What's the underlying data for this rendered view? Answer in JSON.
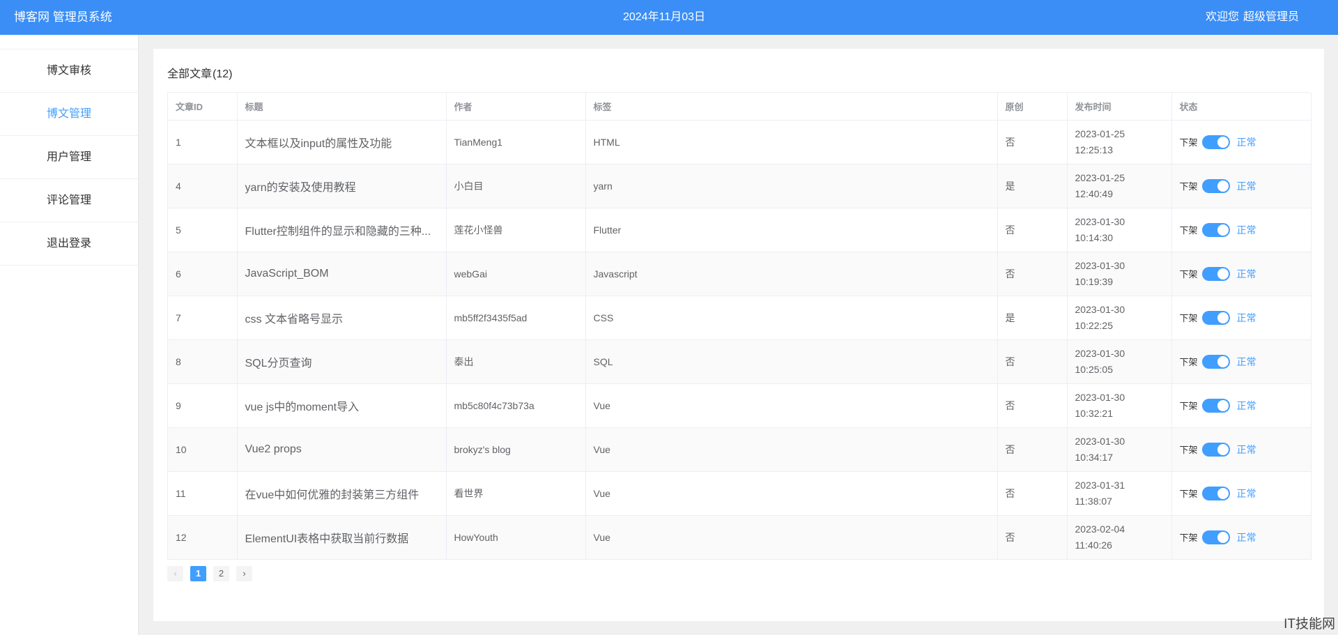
{
  "header": {
    "brand": "博客网 管理员系统",
    "date": "2024年11月03日",
    "welcome": "欢迎您",
    "role": "超级管理员"
  },
  "sidebar": {
    "items": [
      {
        "label": "博文审核"
      },
      {
        "label": "博文管理"
      },
      {
        "label": "用户管理"
      },
      {
        "label": "评论管理"
      },
      {
        "label": "退出登录"
      }
    ]
  },
  "main": {
    "title": "全部文章",
    "count": "(12)"
  },
  "table": {
    "columns": [
      "文章ID",
      "标题",
      "作者",
      "标签",
      "原创",
      "发布时间",
      "状态"
    ],
    "rows": [
      {
        "id": "1",
        "title": "文本框以及input的属性及功能",
        "author": "TianMeng1",
        "tag": "HTML",
        "original": "否",
        "date": "2023-01-25",
        "time": "12:25:13",
        "off": "下架",
        "status": "正常"
      },
      {
        "id": "4",
        "title": "yarn的安装及使用教程",
        "author": "小白目",
        "tag": "yarn",
        "original": "是",
        "date": "2023-01-25",
        "time": "12:40:49",
        "off": "下架",
        "status": "正常"
      },
      {
        "id": "5",
        "title": "Flutter控制组件的显示和隐藏的三种...",
        "author": "莲花小怪兽",
        "tag": "Flutter",
        "original": "否",
        "date": "2023-01-30",
        "time": "10:14:30",
        "off": "下架",
        "status": "正常"
      },
      {
        "id": "6",
        "title": "JavaScript_BOM",
        "author": "webGai",
        "tag": "Javascript",
        "original": "否",
        "date": "2023-01-30",
        "time": "10:19:39",
        "off": "下架",
        "status": "正常"
      },
      {
        "id": "7",
        "title": "css 文本省略号显示",
        "author": "mb5ff2f3435f5ad",
        "tag": "CSS",
        "original": "是",
        "date": "2023-01-30",
        "time": "10:22:25",
        "off": "下架",
        "status": "正常"
      },
      {
        "id": "8",
        "title": "SQL分页查询",
        "author": "泰出",
        "tag": "SQL",
        "original": "否",
        "date": "2023-01-30",
        "time": "10:25:05",
        "off": "下架",
        "status": "正常"
      },
      {
        "id": "9",
        "title": "vue js中的moment导入",
        "author": "mb5c80f4c73b73a",
        "tag": "Vue",
        "original": "否",
        "date": "2023-01-30",
        "time": "10:32:21",
        "off": "下架",
        "status": "正常"
      },
      {
        "id": "10",
        "title": "Vue2 props",
        "author": "brokyz's blog",
        "tag": "Vue",
        "original": "否",
        "date": "2023-01-30",
        "time": "10:34:17",
        "off": "下架",
        "status": "正常"
      },
      {
        "id": "11",
        "title": "在vue中如何优雅的封装第三方组件",
        "author": "看世界",
        "tag": "Vue",
        "original": "否",
        "date": "2023-01-31",
        "time": "11:38:07",
        "off": "下架",
        "status": "正常"
      },
      {
        "id": "12",
        "title": "ElementUI表格中获取当前行数据",
        "author": "HowYouth",
        "tag": "Vue",
        "original": "否",
        "date": "2023-02-04",
        "time": "11:40:26",
        "off": "下架",
        "status": "正常"
      }
    ]
  },
  "pagination": {
    "prev_icon": "chevron-left-icon",
    "pages": [
      "1",
      "2"
    ],
    "current": "1",
    "next_icon": "chevron-right-icon"
  },
  "watermark": "IT技能网"
}
